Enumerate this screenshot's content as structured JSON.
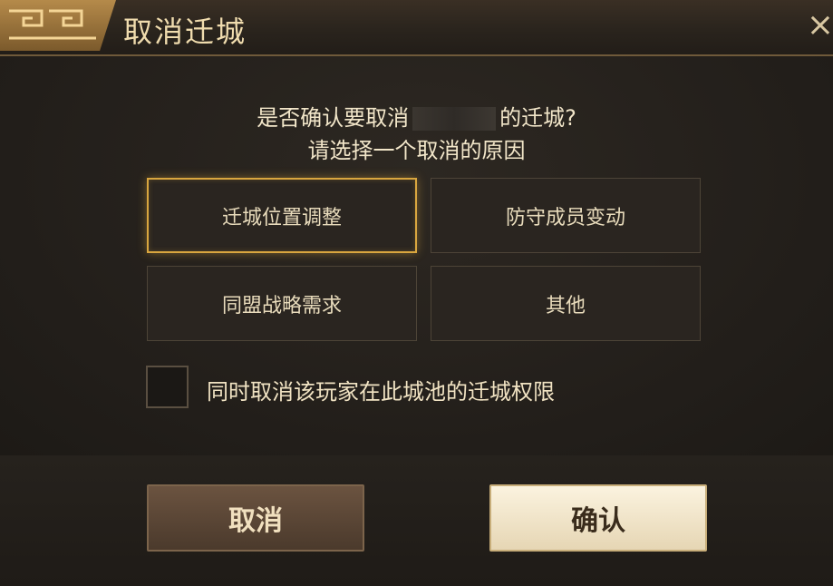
{
  "dialog": {
    "title": "取消迁城",
    "close_icon": "×"
  },
  "message": {
    "line1_prefix": "是否确认要取消",
    "line1_suffix": "的迁城?",
    "line2": "请选择一个取消的原因"
  },
  "reasons": [
    {
      "label": "迁城位置调整",
      "selected": true
    },
    {
      "label": "防守成员变动",
      "selected": false
    },
    {
      "label": "同盟战略需求",
      "selected": false
    },
    {
      "label": "其他",
      "selected": false
    }
  ],
  "revoke_checkbox": {
    "checked": false,
    "label": "同时取消该玩家在此城池的迁城权限"
  },
  "buttons": {
    "cancel": "取消",
    "confirm": "确认"
  },
  "colors": {
    "accent_gold": "#d9a63f",
    "title_text": "#f0dcae"
  }
}
